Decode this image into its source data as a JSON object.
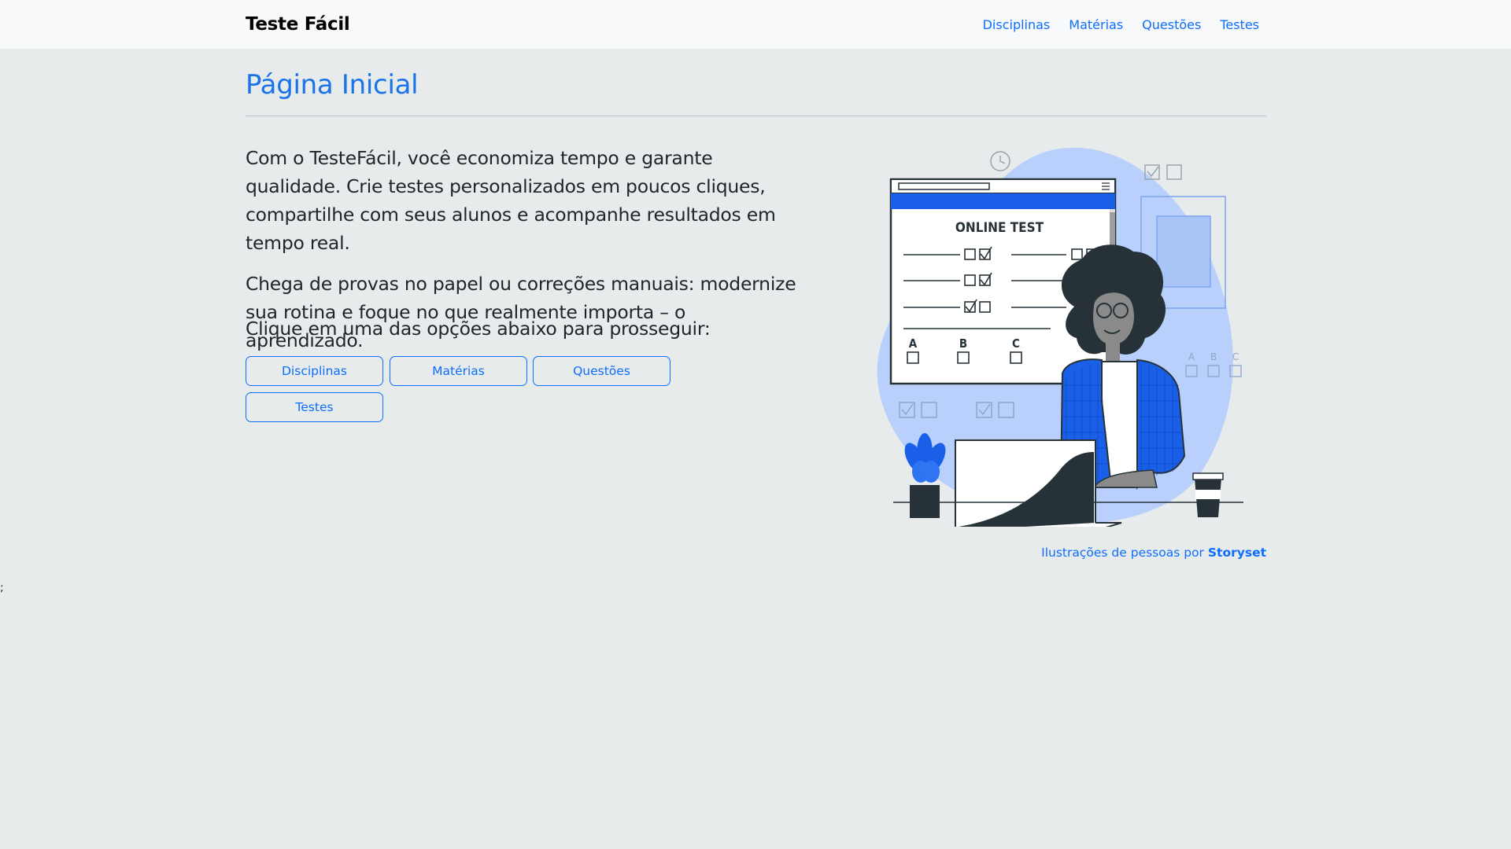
{
  "app": {
    "brand": "Teste Fácil"
  },
  "nav": {
    "links": [
      "Disciplinas",
      "Matérias",
      "Questões",
      "Testes"
    ]
  },
  "main": {
    "title": "Página Inicial",
    "paragraphs": [
      "Com o TesteFácil, você economiza tempo e garante qualidade. Crie testes personalizados em poucos cliques, compartilhe com seus alunos e acompanhe resultados em tempo real.",
      "Chega de provas no papel ou correções manuais: modernize sua rotina e foque no que realmente importa – o aprendizado."
    ],
    "prompt": "Clique em uma das opções abaixo para prosseguir:",
    "buttons": [
      "Disciplinas",
      "Matérias",
      "Questões",
      "Testes"
    ]
  },
  "illustration": {
    "test_title": "ONLINE TEST",
    "options": [
      "A",
      "B",
      "C"
    ],
    "side_options": [
      "A",
      "B",
      "C"
    ]
  },
  "credit": {
    "prefix": "Ilustrações de pessoas por",
    "link": "Storyset"
  },
  "stray_text": ";",
  "colors": {
    "accent": "#0d6efd",
    "background": "#e8ebec",
    "navbar": "#f8f9fa",
    "illustration_blue": "#1a5fe8",
    "blob": "#b8d0fb"
  }
}
